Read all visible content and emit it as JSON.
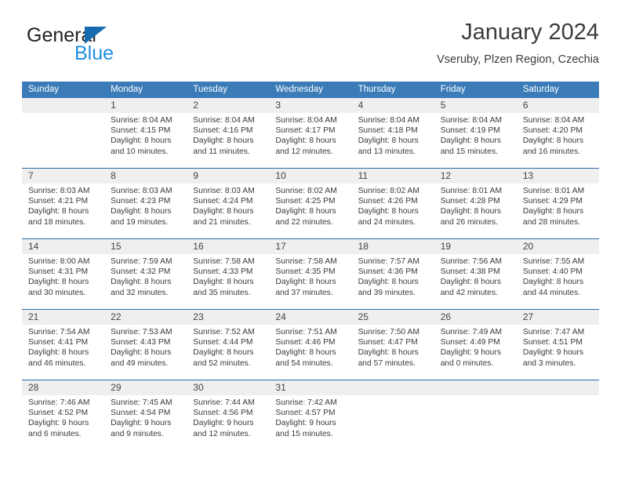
{
  "brand": {
    "name_part1": "General",
    "name_part2": "Blue",
    "triangle_color": "#1769b0",
    "blue_text_color": "#1f8fe0"
  },
  "header": {
    "title": "January 2024",
    "subtitle": "Vseruby, Plzen Region, Czechia"
  },
  "theme": {
    "header_row_bg": "#3b7cb8",
    "week_divider": "#2b6ca8",
    "daynum_bg": "#efefef",
    "text": "#3a3a3a"
  },
  "weekdays": [
    "Sunday",
    "Monday",
    "Tuesday",
    "Wednesday",
    "Thursday",
    "Friday",
    "Saturday"
  ],
  "weeks": [
    [
      {
        "day": "",
        "sunrise": "",
        "sunset": "",
        "daylight1": "",
        "daylight2": ""
      },
      {
        "day": "1",
        "sunrise": "Sunrise: 8:04 AM",
        "sunset": "Sunset: 4:15 PM",
        "daylight1": "Daylight: 8 hours",
        "daylight2": "and 10 minutes."
      },
      {
        "day": "2",
        "sunrise": "Sunrise: 8:04 AM",
        "sunset": "Sunset: 4:16 PM",
        "daylight1": "Daylight: 8 hours",
        "daylight2": "and 11 minutes."
      },
      {
        "day": "3",
        "sunrise": "Sunrise: 8:04 AM",
        "sunset": "Sunset: 4:17 PM",
        "daylight1": "Daylight: 8 hours",
        "daylight2": "and 12 minutes."
      },
      {
        "day": "4",
        "sunrise": "Sunrise: 8:04 AM",
        "sunset": "Sunset: 4:18 PM",
        "daylight1": "Daylight: 8 hours",
        "daylight2": "and 13 minutes."
      },
      {
        "day": "5",
        "sunrise": "Sunrise: 8:04 AM",
        "sunset": "Sunset: 4:19 PM",
        "daylight1": "Daylight: 8 hours",
        "daylight2": "and 15 minutes."
      },
      {
        "day": "6",
        "sunrise": "Sunrise: 8:04 AM",
        "sunset": "Sunset: 4:20 PM",
        "daylight1": "Daylight: 8 hours",
        "daylight2": "and 16 minutes."
      }
    ],
    [
      {
        "day": "7",
        "sunrise": "Sunrise: 8:03 AM",
        "sunset": "Sunset: 4:21 PM",
        "daylight1": "Daylight: 8 hours",
        "daylight2": "and 18 minutes."
      },
      {
        "day": "8",
        "sunrise": "Sunrise: 8:03 AM",
        "sunset": "Sunset: 4:23 PM",
        "daylight1": "Daylight: 8 hours",
        "daylight2": "and 19 minutes."
      },
      {
        "day": "9",
        "sunrise": "Sunrise: 8:03 AM",
        "sunset": "Sunset: 4:24 PM",
        "daylight1": "Daylight: 8 hours",
        "daylight2": "and 21 minutes."
      },
      {
        "day": "10",
        "sunrise": "Sunrise: 8:02 AM",
        "sunset": "Sunset: 4:25 PM",
        "daylight1": "Daylight: 8 hours",
        "daylight2": "and 22 minutes."
      },
      {
        "day": "11",
        "sunrise": "Sunrise: 8:02 AM",
        "sunset": "Sunset: 4:26 PM",
        "daylight1": "Daylight: 8 hours",
        "daylight2": "and 24 minutes."
      },
      {
        "day": "12",
        "sunrise": "Sunrise: 8:01 AM",
        "sunset": "Sunset: 4:28 PM",
        "daylight1": "Daylight: 8 hours",
        "daylight2": "and 26 minutes."
      },
      {
        "day": "13",
        "sunrise": "Sunrise: 8:01 AM",
        "sunset": "Sunset: 4:29 PM",
        "daylight1": "Daylight: 8 hours",
        "daylight2": "and 28 minutes."
      }
    ],
    [
      {
        "day": "14",
        "sunrise": "Sunrise: 8:00 AM",
        "sunset": "Sunset: 4:31 PM",
        "daylight1": "Daylight: 8 hours",
        "daylight2": "and 30 minutes."
      },
      {
        "day": "15",
        "sunrise": "Sunrise: 7:59 AM",
        "sunset": "Sunset: 4:32 PM",
        "daylight1": "Daylight: 8 hours",
        "daylight2": "and 32 minutes."
      },
      {
        "day": "16",
        "sunrise": "Sunrise: 7:58 AM",
        "sunset": "Sunset: 4:33 PM",
        "daylight1": "Daylight: 8 hours",
        "daylight2": "and 35 minutes."
      },
      {
        "day": "17",
        "sunrise": "Sunrise: 7:58 AM",
        "sunset": "Sunset: 4:35 PM",
        "daylight1": "Daylight: 8 hours",
        "daylight2": "and 37 minutes."
      },
      {
        "day": "18",
        "sunrise": "Sunrise: 7:57 AM",
        "sunset": "Sunset: 4:36 PM",
        "daylight1": "Daylight: 8 hours",
        "daylight2": "and 39 minutes."
      },
      {
        "day": "19",
        "sunrise": "Sunrise: 7:56 AM",
        "sunset": "Sunset: 4:38 PM",
        "daylight1": "Daylight: 8 hours",
        "daylight2": "and 42 minutes."
      },
      {
        "day": "20",
        "sunrise": "Sunrise: 7:55 AM",
        "sunset": "Sunset: 4:40 PM",
        "daylight1": "Daylight: 8 hours",
        "daylight2": "and 44 minutes."
      }
    ],
    [
      {
        "day": "21",
        "sunrise": "Sunrise: 7:54 AM",
        "sunset": "Sunset: 4:41 PM",
        "daylight1": "Daylight: 8 hours",
        "daylight2": "and 46 minutes."
      },
      {
        "day": "22",
        "sunrise": "Sunrise: 7:53 AM",
        "sunset": "Sunset: 4:43 PM",
        "daylight1": "Daylight: 8 hours",
        "daylight2": "and 49 minutes."
      },
      {
        "day": "23",
        "sunrise": "Sunrise: 7:52 AM",
        "sunset": "Sunset: 4:44 PM",
        "daylight1": "Daylight: 8 hours",
        "daylight2": "and 52 minutes."
      },
      {
        "day": "24",
        "sunrise": "Sunrise: 7:51 AM",
        "sunset": "Sunset: 4:46 PM",
        "daylight1": "Daylight: 8 hours",
        "daylight2": "and 54 minutes."
      },
      {
        "day": "25",
        "sunrise": "Sunrise: 7:50 AM",
        "sunset": "Sunset: 4:47 PM",
        "daylight1": "Daylight: 8 hours",
        "daylight2": "and 57 minutes."
      },
      {
        "day": "26",
        "sunrise": "Sunrise: 7:49 AM",
        "sunset": "Sunset: 4:49 PM",
        "daylight1": "Daylight: 9 hours",
        "daylight2": "and 0 minutes."
      },
      {
        "day": "27",
        "sunrise": "Sunrise: 7:47 AM",
        "sunset": "Sunset: 4:51 PM",
        "daylight1": "Daylight: 9 hours",
        "daylight2": "and 3 minutes."
      }
    ],
    [
      {
        "day": "28",
        "sunrise": "Sunrise: 7:46 AM",
        "sunset": "Sunset: 4:52 PM",
        "daylight1": "Daylight: 9 hours",
        "daylight2": "and 6 minutes."
      },
      {
        "day": "29",
        "sunrise": "Sunrise: 7:45 AM",
        "sunset": "Sunset: 4:54 PM",
        "daylight1": "Daylight: 9 hours",
        "daylight2": "and 9 minutes."
      },
      {
        "day": "30",
        "sunrise": "Sunrise: 7:44 AM",
        "sunset": "Sunset: 4:56 PM",
        "daylight1": "Daylight: 9 hours",
        "daylight2": "and 12 minutes."
      },
      {
        "day": "31",
        "sunrise": "Sunrise: 7:42 AM",
        "sunset": "Sunset: 4:57 PM",
        "daylight1": "Daylight: 9 hours",
        "daylight2": "and 15 minutes."
      },
      {
        "day": "",
        "sunrise": "",
        "sunset": "",
        "daylight1": "",
        "daylight2": ""
      },
      {
        "day": "",
        "sunrise": "",
        "sunset": "",
        "daylight1": "",
        "daylight2": ""
      },
      {
        "day": "",
        "sunrise": "",
        "sunset": "",
        "daylight1": "",
        "daylight2": ""
      }
    ]
  ]
}
